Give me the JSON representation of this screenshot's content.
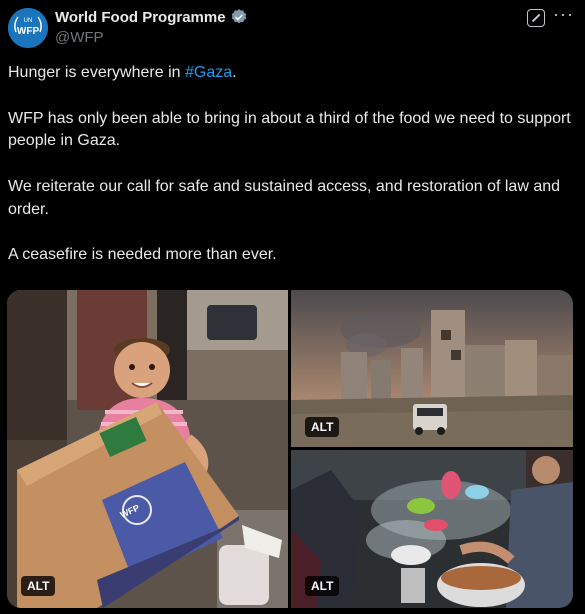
{
  "author": {
    "display_name": "World Food Programme",
    "handle": "@WFP",
    "avatar_text": "WFP",
    "avatar_small_text": "UN"
  },
  "tweet": {
    "line1_prefix": "Hunger is everywhere in ",
    "line1_hashtag": "#Gaza",
    "line1_suffix": ".",
    "para2": "WFP has only been able to bring in about a third of the food we need to support people in Gaza.",
    "para3": "We reiterate our call for safe and sustained access, and restoration of law and order.",
    "para4": "A ceasefire is needed more than ever."
  },
  "media": {
    "alt_label": "ALT",
    "box_text": "WFP"
  },
  "colors": {
    "background": "#000000",
    "text": "#e7e9ea",
    "secondary": "#71767b",
    "link": "#1d9bf0",
    "avatar": "#1b75bc"
  },
  "icons": {
    "verified": "verified-badge-icon",
    "grok": "grok-icon",
    "more": "more-icon"
  }
}
